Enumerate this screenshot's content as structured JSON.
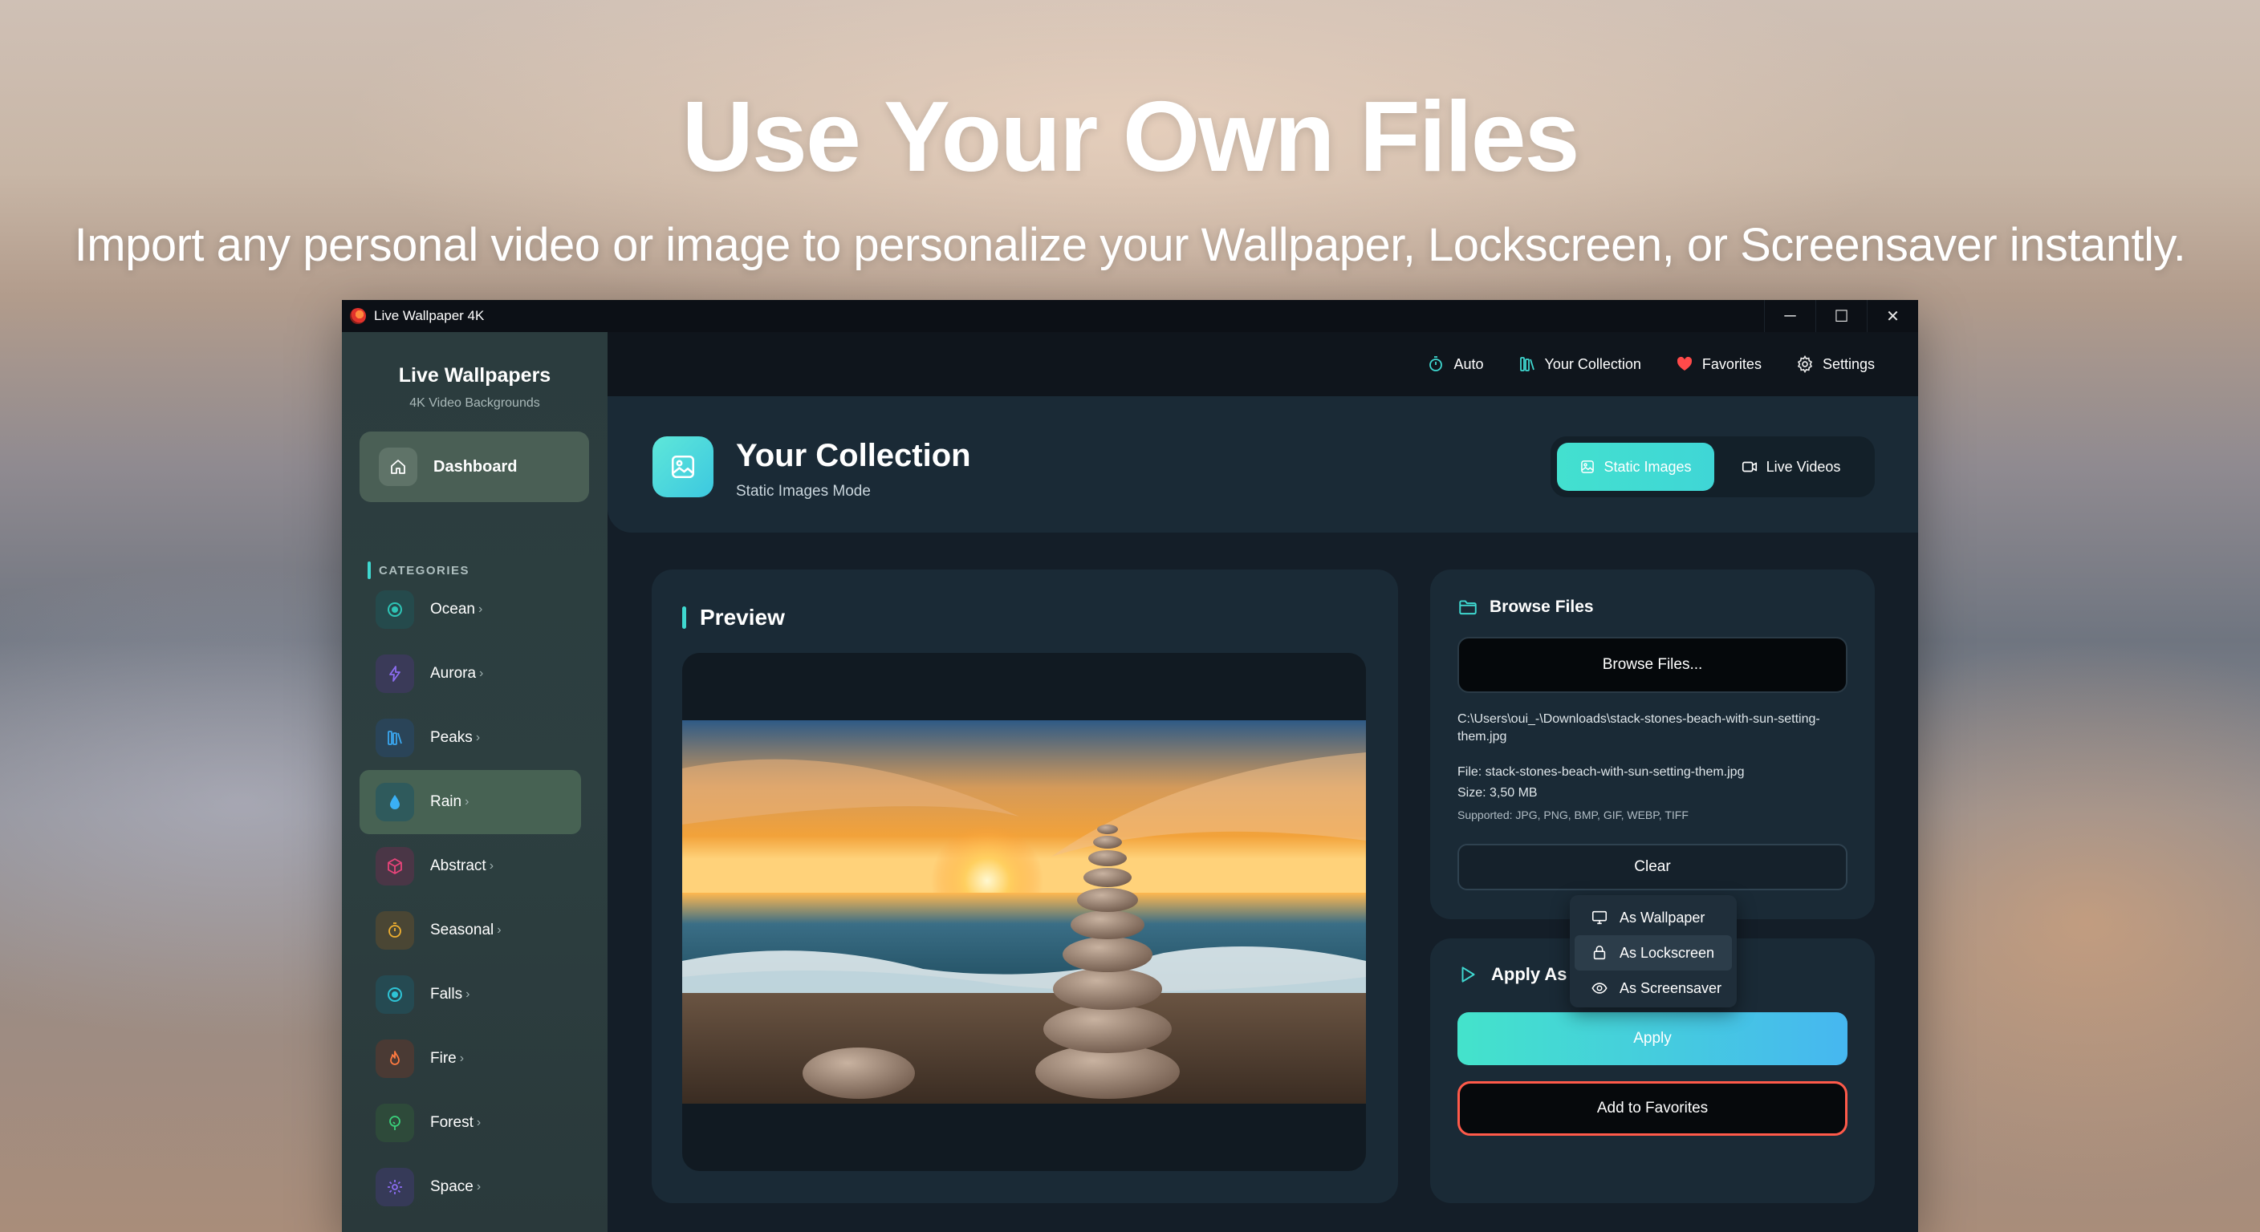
{
  "hero": {
    "title": "Use Your Own Files",
    "subtitle": "Import any personal video or image to personalize your Wallpaper, Lockscreen, or Screensaver instantly."
  },
  "window": {
    "title": "Live Wallpaper 4K",
    "controls": {
      "minimize": "─",
      "maximize": "☐",
      "close": "✕"
    }
  },
  "sidebar": {
    "brand_title": "Live Wallpapers",
    "brand_subtitle": "4K Video Backgrounds",
    "dashboard_label": "Dashboard",
    "categories_heading": "CATEGORIES",
    "chevron": "›",
    "items": [
      {
        "label": "Ocean",
        "icon": "target-icon",
        "color": "#2ec4b6",
        "bg": "#254a4c"
      },
      {
        "label": "Aurora",
        "icon": "bolt-icon",
        "color": "#8b6cf0",
        "bg": "#3a3a58"
      },
      {
        "label": "Peaks",
        "icon": "bars-icon",
        "color": "#3aa7f0",
        "bg": "#2a4458"
      },
      {
        "label": "Rain",
        "icon": "drop-icon",
        "color": "#3ab0f5",
        "bg": "#2f5a5c",
        "active": true
      },
      {
        "label": "Abstract",
        "icon": "cube-icon",
        "color": "#e8447a",
        "bg": "#4a3646"
      },
      {
        "label": "Seasonal",
        "icon": "timer-icon",
        "color": "#f0b030",
        "bg": "#4a4634"
      },
      {
        "label": "Falls",
        "icon": "target-icon",
        "color": "#2ec4d6",
        "bg": "#254a52"
      },
      {
        "label": "Fire",
        "icon": "flame-icon",
        "color": "#ff7a40",
        "bg": "#4a3a34"
      },
      {
        "label": "Forest",
        "icon": "tree-icon",
        "color": "#3ad07a",
        "bg": "#2e4a3a"
      },
      {
        "label": "Space",
        "icon": "sparkle-icon",
        "color": "#8a6cf0",
        "bg": "#363a58"
      }
    ]
  },
  "topnav": {
    "items": [
      {
        "label": "Auto",
        "icon": "timer-icon"
      },
      {
        "label": "Your Collection",
        "icon": "books-icon"
      },
      {
        "label": "Favorites",
        "icon": "heart-icon"
      },
      {
        "label": "Settings",
        "icon": "gear-icon"
      }
    ]
  },
  "header": {
    "title": "Your Collection",
    "subtitle": "Static Images Mode",
    "mode_static": "Static Images",
    "mode_live": "Live Videos"
  },
  "preview": {
    "title": "Preview"
  },
  "browse": {
    "title": "Browse Files",
    "button": "Browse Files...",
    "path": "C:\\Users\\oui_-\\Downloads\\stack-stones-beach-with-sun-setting-them.jpg",
    "file": "File: stack-stones-beach-with-sun-setting-them.jpg",
    "size": "Size: 3,50 MB",
    "supported": "Supported: JPG, PNG, BMP, GIF, WEBP, TIFF",
    "clear": "Clear"
  },
  "apply": {
    "title": "Apply As",
    "apply_button": "Apply",
    "favorites_button": "Add to Favorites"
  },
  "dropdown": {
    "options": [
      {
        "label": "As Wallpaper",
        "icon": "monitor-icon"
      },
      {
        "label": "As Lockscreen",
        "icon": "lock-icon",
        "hover": true
      },
      {
        "label": "As Screensaver",
        "icon": "eye-icon"
      }
    ]
  },
  "colors": {
    "accent": "#3fd8d0",
    "favorites_border": "#ff5a4a",
    "heart": "#ff4a4a"
  }
}
